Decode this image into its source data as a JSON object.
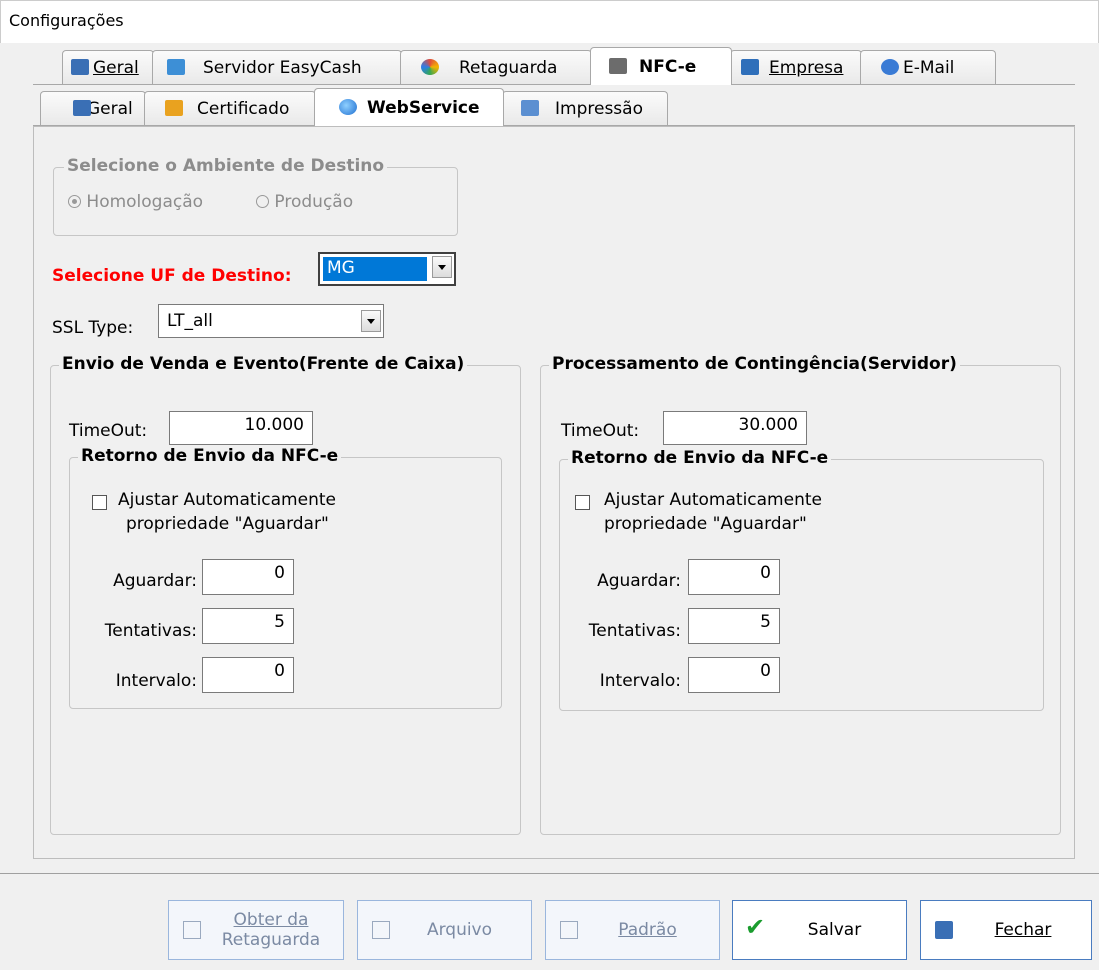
{
  "window": {
    "title": "Configurações"
  },
  "top_tabs": [
    {
      "label": "Geral",
      "icon": "grid-icon",
      "active": false
    },
    {
      "label": "Servidor EasyCash",
      "icon": "database-icon",
      "active": false
    },
    {
      "label": "Retaguarda",
      "icon": "sync-icon",
      "active": false
    },
    {
      "label": "NFC-e",
      "icon": "nfce-icon",
      "active": true
    },
    {
      "label": "Empresa",
      "icon": "building-icon",
      "active": false
    },
    {
      "label": "E-Mail",
      "icon": "at-icon",
      "active": false
    }
  ],
  "sub_tabs": [
    {
      "label": "Geral",
      "icon": "grid-icon",
      "active": false
    },
    {
      "label": "Certificado",
      "icon": "certificate-icon",
      "active": false
    },
    {
      "label": "WebService",
      "icon": "globe-icon",
      "active": true
    },
    {
      "label": "Impressão",
      "icon": "printer-icon",
      "active": false
    }
  ],
  "ambiente": {
    "legend": "Selecione o Ambiente de Destino",
    "options": [
      "Homologação",
      "Produção"
    ],
    "selected": "Homologação"
  },
  "uf": {
    "label": "Selecione UF de Destino:",
    "value": "MG",
    "label_color": "#ff0000"
  },
  "ssl": {
    "label": "SSL Type:",
    "value": "LT_all"
  },
  "envio": {
    "legend": "Envio de Venda e Evento(Frente de Caixa)",
    "timeout_label": "TimeOut:",
    "timeout_value": "10.000",
    "retorno": {
      "legend": "Retorno de Envio da NFC-e",
      "check_label_1": "Ajustar Automaticamente",
      "check_label_2": "propriedade \"Aguardar\"",
      "checked": false,
      "aguardar_label": "Aguardar:",
      "aguardar_value": "0",
      "tentativas_label": "Tentativas:",
      "tentativas_value": "5",
      "intervalo_label": "Intervalo:",
      "intervalo_value": "0"
    }
  },
  "contingencia": {
    "legend": "Processamento de Contingência(Servidor)",
    "timeout_label": "TimeOut:",
    "timeout_value": "30.000",
    "retorno": {
      "legend": "Retorno de Envio da NFC-e",
      "check_label_1": "Ajustar Automaticamente",
      "check_label_2": "propriedade \"Aguardar\"",
      "checked": false,
      "aguardar_label": "Aguardar:",
      "aguardar_value": "0",
      "tentativas_label": "Tentativas:",
      "tentativas_value": "5",
      "intervalo_label": "Intervalo:",
      "intervalo_value": "0"
    }
  },
  "buttons": {
    "obter_1": "Obter da",
    "obter_2": "Retaguarda",
    "arquivo": "Arquivo",
    "padrao": "Padrão",
    "salvar": "Salvar",
    "fechar": "Fechar"
  }
}
